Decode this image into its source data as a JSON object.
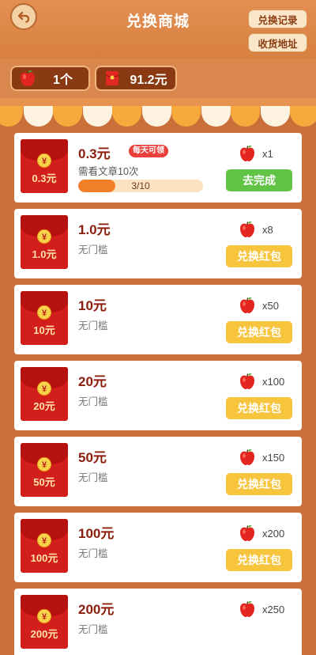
{
  "header": {
    "title": "兑换商城",
    "records_label": "兑换记录",
    "address_label": "收货地址"
  },
  "balance": {
    "apples": "1个",
    "cash": "91.2元"
  },
  "colors": {
    "header_bg": "#e28f52",
    "envelope_red": "#d31f1c",
    "button_green": "#62c447",
    "button_yellow": "#f6c43d",
    "badge_red": "#e9403c"
  },
  "items": [
    {
      "envelope_amount": "0.3元",
      "price": "0.3元",
      "badge": "每天可领",
      "condition": "需看文章10次",
      "progress": {
        "text": "3/10",
        "value": 0.3
      },
      "cost": "x1",
      "action": "去完成",
      "action_style": "green"
    },
    {
      "envelope_amount": "1.0元",
      "price": "1.0元",
      "condition": "无门槛",
      "cost": "x8",
      "action": "兑换红包",
      "action_style": "yellow"
    },
    {
      "envelope_amount": "10元",
      "price": "10元",
      "condition": "无门槛",
      "cost": "x50",
      "action": "兑换红包",
      "action_style": "yellow"
    },
    {
      "envelope_amount": "20元",
      "price": "20元",
      "condition": "无门槛",
      "cost": "x100",
      "action": "兑换红包",
      "action_style": "yellow"
    },
    {
      "envelope_amount": "50元",
      "price": "50元",
      "condition": "无门槛",
      "cost": "x150",
      "action": "兑换红包",
      "action_style": "yellow"
    },
    {
      "envelope_amount": "100元",
      "price": "100元",
      "condition": "无门槛",
      "cost": "x200",
      "action": "兑换红包",
      "action_style": "yellow"
    },
    {
      "envelope_amount": "200元",
      "price": "200元",
      "condition": "无门槛",
      "cost": "x250",
      "action": "",
      "action_style": "yellow"
    }
  ]
}
